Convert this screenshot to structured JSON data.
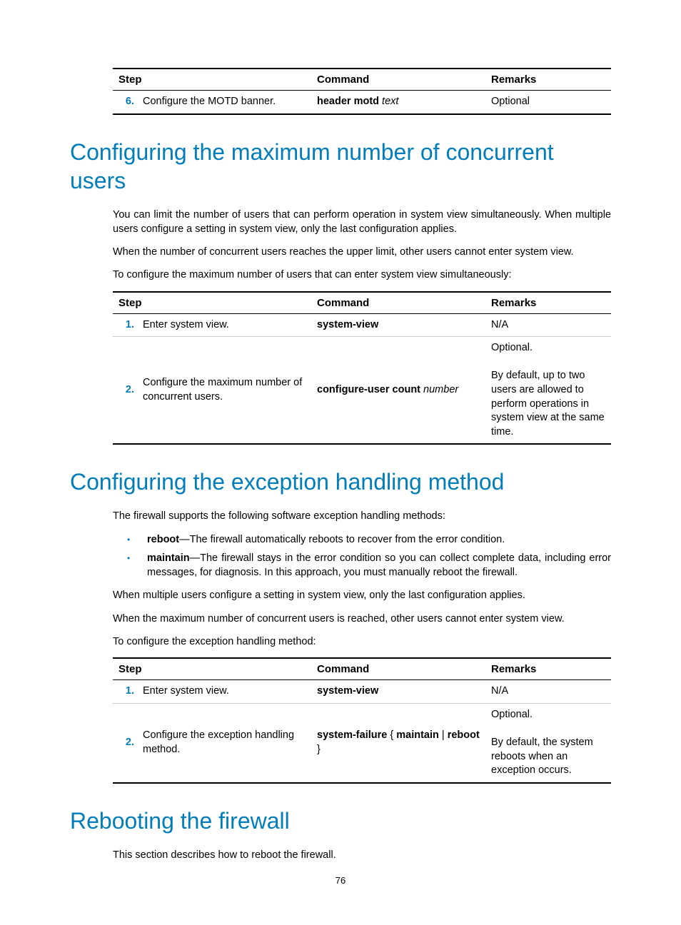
{
  "table1": {
    "headers": [
      "Step",
      "Command",
      "Remarks"
    ],
    "row": {
      "num": "6.",
      "step": "Configure the MOTD banner.",
      "cmd_bold": "header motd",
      "cmd_italic": "text",
      "remarks": "Optional"
    }
  },
  "section1": {
    "heading": "Configuring the maximum number of concurrent users",
    "p1": "You can limit the number of users that can perform operation in system view simultaneously. When multiple users configure a setting in system view, only the last configuration applies.",
    "p2": "When the number of concurrent users reaches the upper limit, other users cannot enter system view.",
    "p3": "To configure the maximum number of users that can enter system view simultaneously:",
    "table": {
      "headers": [
        "Step",
        "Command",
        "Remarks"
      ],
      "rows": [
        {
          "num": "1.",
          "step": "Enter system view.",
          "cmd_bold": "system-view",
          "cmd_italic": "",
          "remarks": "N/A"
        },
        {
          "num": "2.",
          "step": "Configure the maximum number of concurrent users.",
          "cmd_bold": "configure-user count",
          "cmd_italic": "number",
          "remarks_l1": "Optional.",
          "remarks_l2": "By default, up to two users are allowed to perform operations in system view at the same time."
        }
      ]
    }
  },
  "section2": {
    "heading": "Configuring the exception handling method",
    "p1": "The firewall supports the following software exception handling methods:",
    "li1_bold": "reboot",
    "li1_rest": "—The firewall automatically reboots to recover from the error condition.",
    "li2_bold": "maintain",
    "li2_rest": "—The firewall stays in the error condition so you can collect complete data, including error messages, for diagnosis. In this approach, you must manually reboot the firewall.",
    "p2": "When multiple users configure a setting in system view, only the last configuration applies.",
    "p3": "When the maximum number of concurrent users is reached, other users cannot enter system view.",
    "p4": "To configure the exception handling method:",
    "table": {
      "headers": [
        "Step",
        "Command",
        "Remarks"
      ],
      "rows": [
        {
          "num": "1.",
          "step": "Enter system view.",
          "cmd_bold": "system-view",
          "remarks": "N/A"
        },
        {
          "num": "2.",
          "step": "Configure the exception handling method.",
          "cmd_html": "system-failure { maintain | reboot }",
          "remarks_l1": "Optional.",
          "remarks_l2": "By default, the system reboots when an exception occurs."
        }
      ]
    }
  },
  "section3": {
    "heading": "Rebooting the firewall",
    "p1": "This section describes how to reboot the firewall."
  },
  "pagenum": "76"
}
